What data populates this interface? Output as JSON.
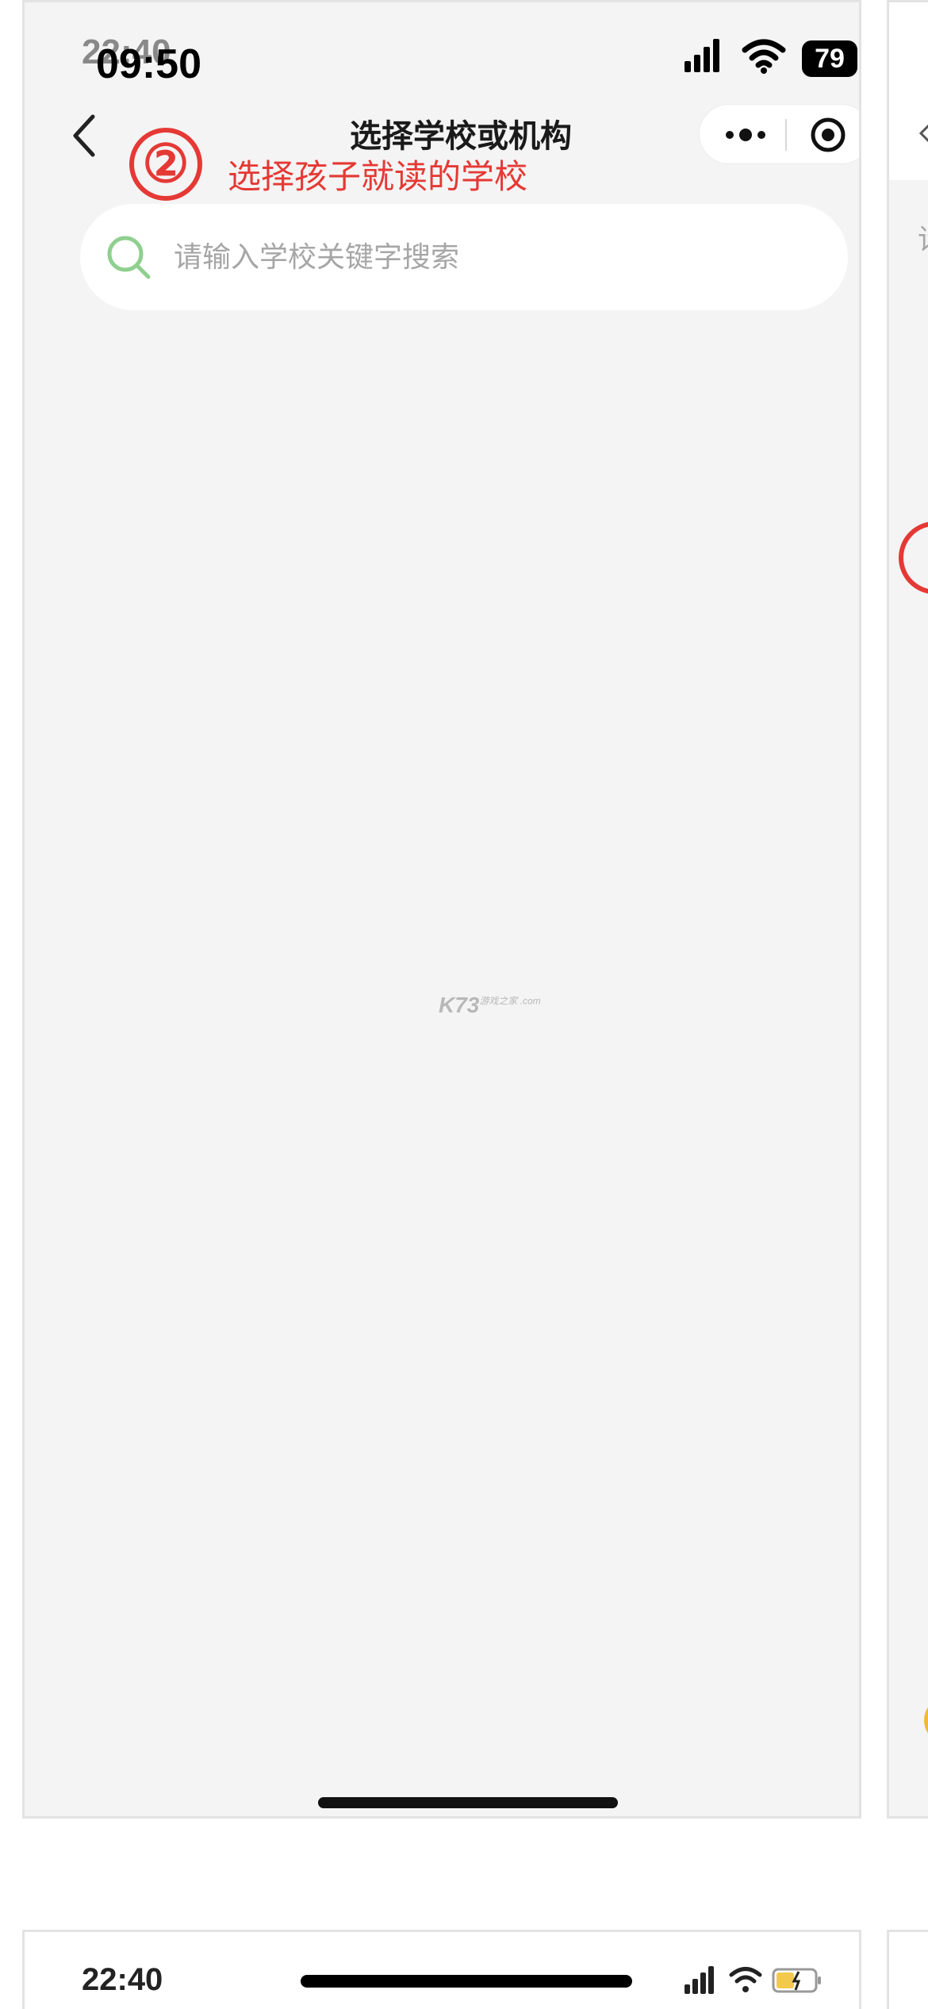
{
  "status_bar": {
    "time_ghost": "22:40",
    "time": "09:50",
    "battery_level": "79"
  },
  "nav": {
    "title": "选择学校或机构"
  },
  "annotation": {
    "step_number": "②",
    "text": "选择孩子就读的学校"
  },
  "search": {
    "placeholder": "请输入学校关键字搜索",
    "value": ""
  },
  "watermark": {
    "logo_text": "K73",
    "sub_text": "游戏之家 .com"
  },
  "right_panel": {
    "hint_char": "请"
  },
  "bottom_screen": {
    "time": "22:40"
  },
  "colors": {
    "annotation_red": "#e53935",
    "search_icon_green": "#8fcf8f",
    "page_background": "#f4f4f4"
  }
}
